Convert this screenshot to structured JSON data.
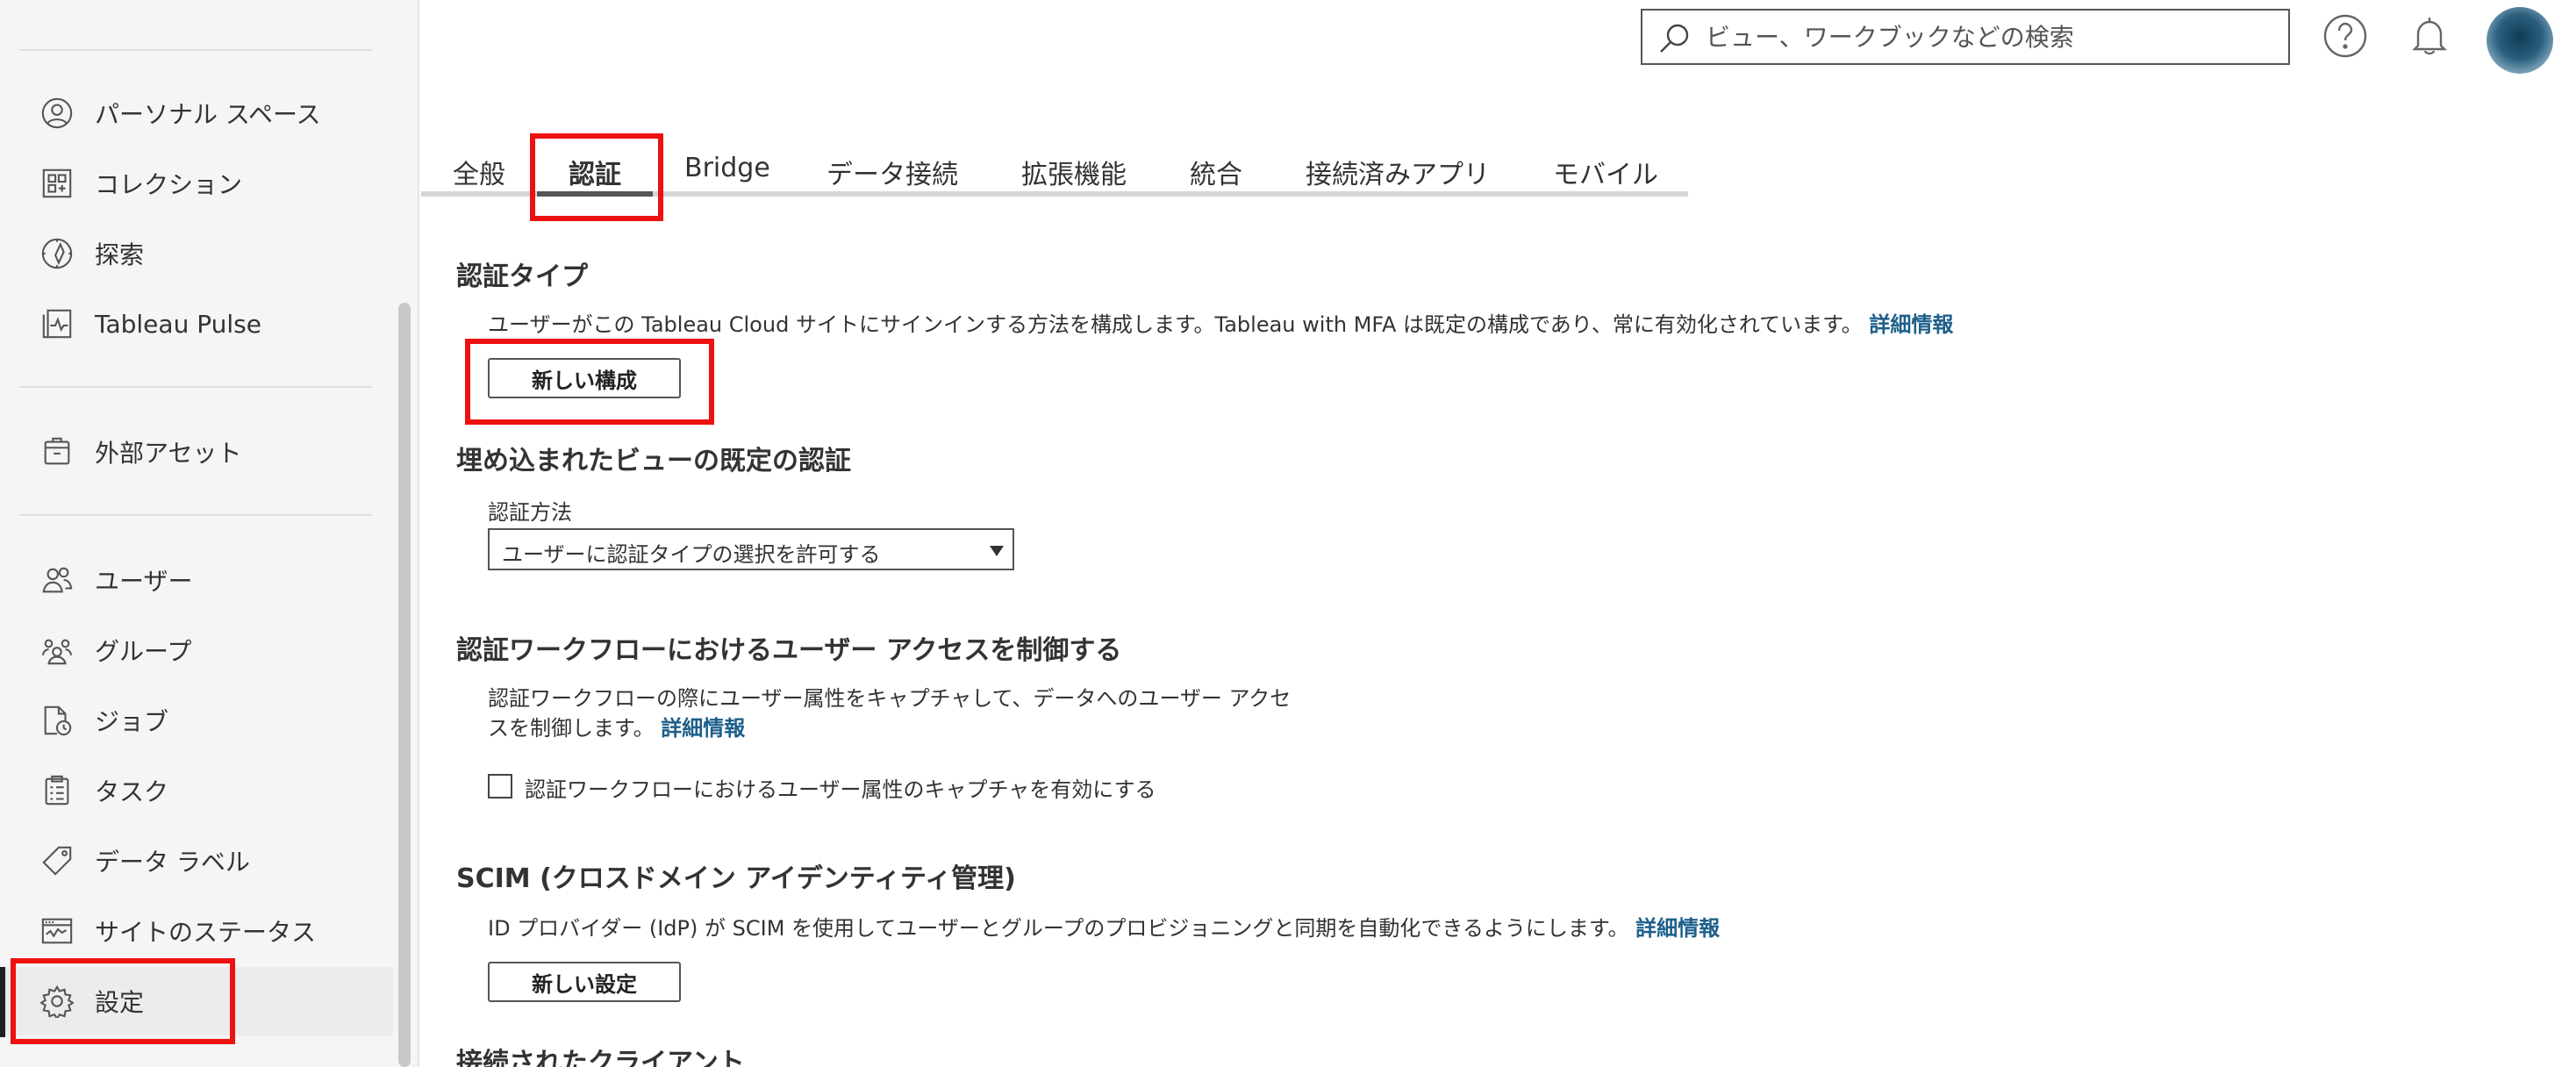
{
  "sidebar": {
    "items": [
      {
        "label": "パーソナル スペース",
        "icon": "person-circle-icon"
      },
      {
        "label": "コレクション",
        "icon": "collection-icon"
      },
      {
        "label": "探索",
        "icon": "compass-icon"
      },
      {
        "label": "Tableau Pulse",
        "icon": "pulse-icon"
      },
      {
        "label": "外部アセット",
        "icon": "archive-icon"
      },
      {
        "label": "ユーザー",
        "icon": "users-icon"
      },
      {
        "label": "グループ",
        "icon": "group-icon"
      },
      {
        "label": "ジョブ",
        "icon": "job-icon"
      },
      {
        "label": "タスク",
        "icon": "task-icon"
      },
      {
        "label": "データ ラベル",
        "icon": "tag-icon"
      },
      {
        "label": "サイトのステータス",
        "icon": "site-status-icon"
      },
      {
        "label": "設定",
        "icon": "gear-icon"
      }
    ]
  },
  "header": {
    "search_placeholder": "ビュー、ワークブックなどの検索"
  },
  "tabs": [
    "全般",
    "認証",
    "Bridge",
    "データ接続",
    "拡張機能",
    "統合",
    "接続済みアプリ",
    "モバイル"
  ],
  "active_tab": "認証",
  "auth_type": {
    "title": "認証タイプ",
    "desc": "ユーザーがこの Tableau Cloud サイトにサインインする方法を構成します。Tableau with MFA は既定の構成であり、常に有効化されています。",
    "link": "詳細情報",
    "button": "新しい構成"
  },
  "embedded": {
    "title": "埋め込まれたビューの既定の認証",
    "field_label": "認証方法",
    "selected": "ユーザーに認証タイプの選択を許可する"
  },
  "workflow": {
    "title": "認証ワークフローにおけるユーザー アクセスを制御する",
    "desc_line1": "認証ワークフローの際にユーザー属性をキャプチャして、データへのユーザー アクセ",
    "desc_line2": "スを制御します。",
    "link": "詳細情報",
    "checkbox_label": "認証ワークフローにおけるユーザー属性のキャプチャを有効にする"
  },
  "scim": {
    "title": "SCIM (クロスドメイン アイデンティティ管理)",
    "desc": "ID プロバイダー (IdP) が SCIM を使用してユーザーとグループのプロビジョニングと同期を自動化できるようにします。",
    "link": "詳細情報",
    "button": "新しい設定"
  },
  "connected_clients": {
    "title": "接続されたクライアント"
  },
  "colors": {
    "highlight": "#ee1111",
    "link": "#1d5f8a",
    "sidebar_bg": "#f5f5f5"
  }
}
